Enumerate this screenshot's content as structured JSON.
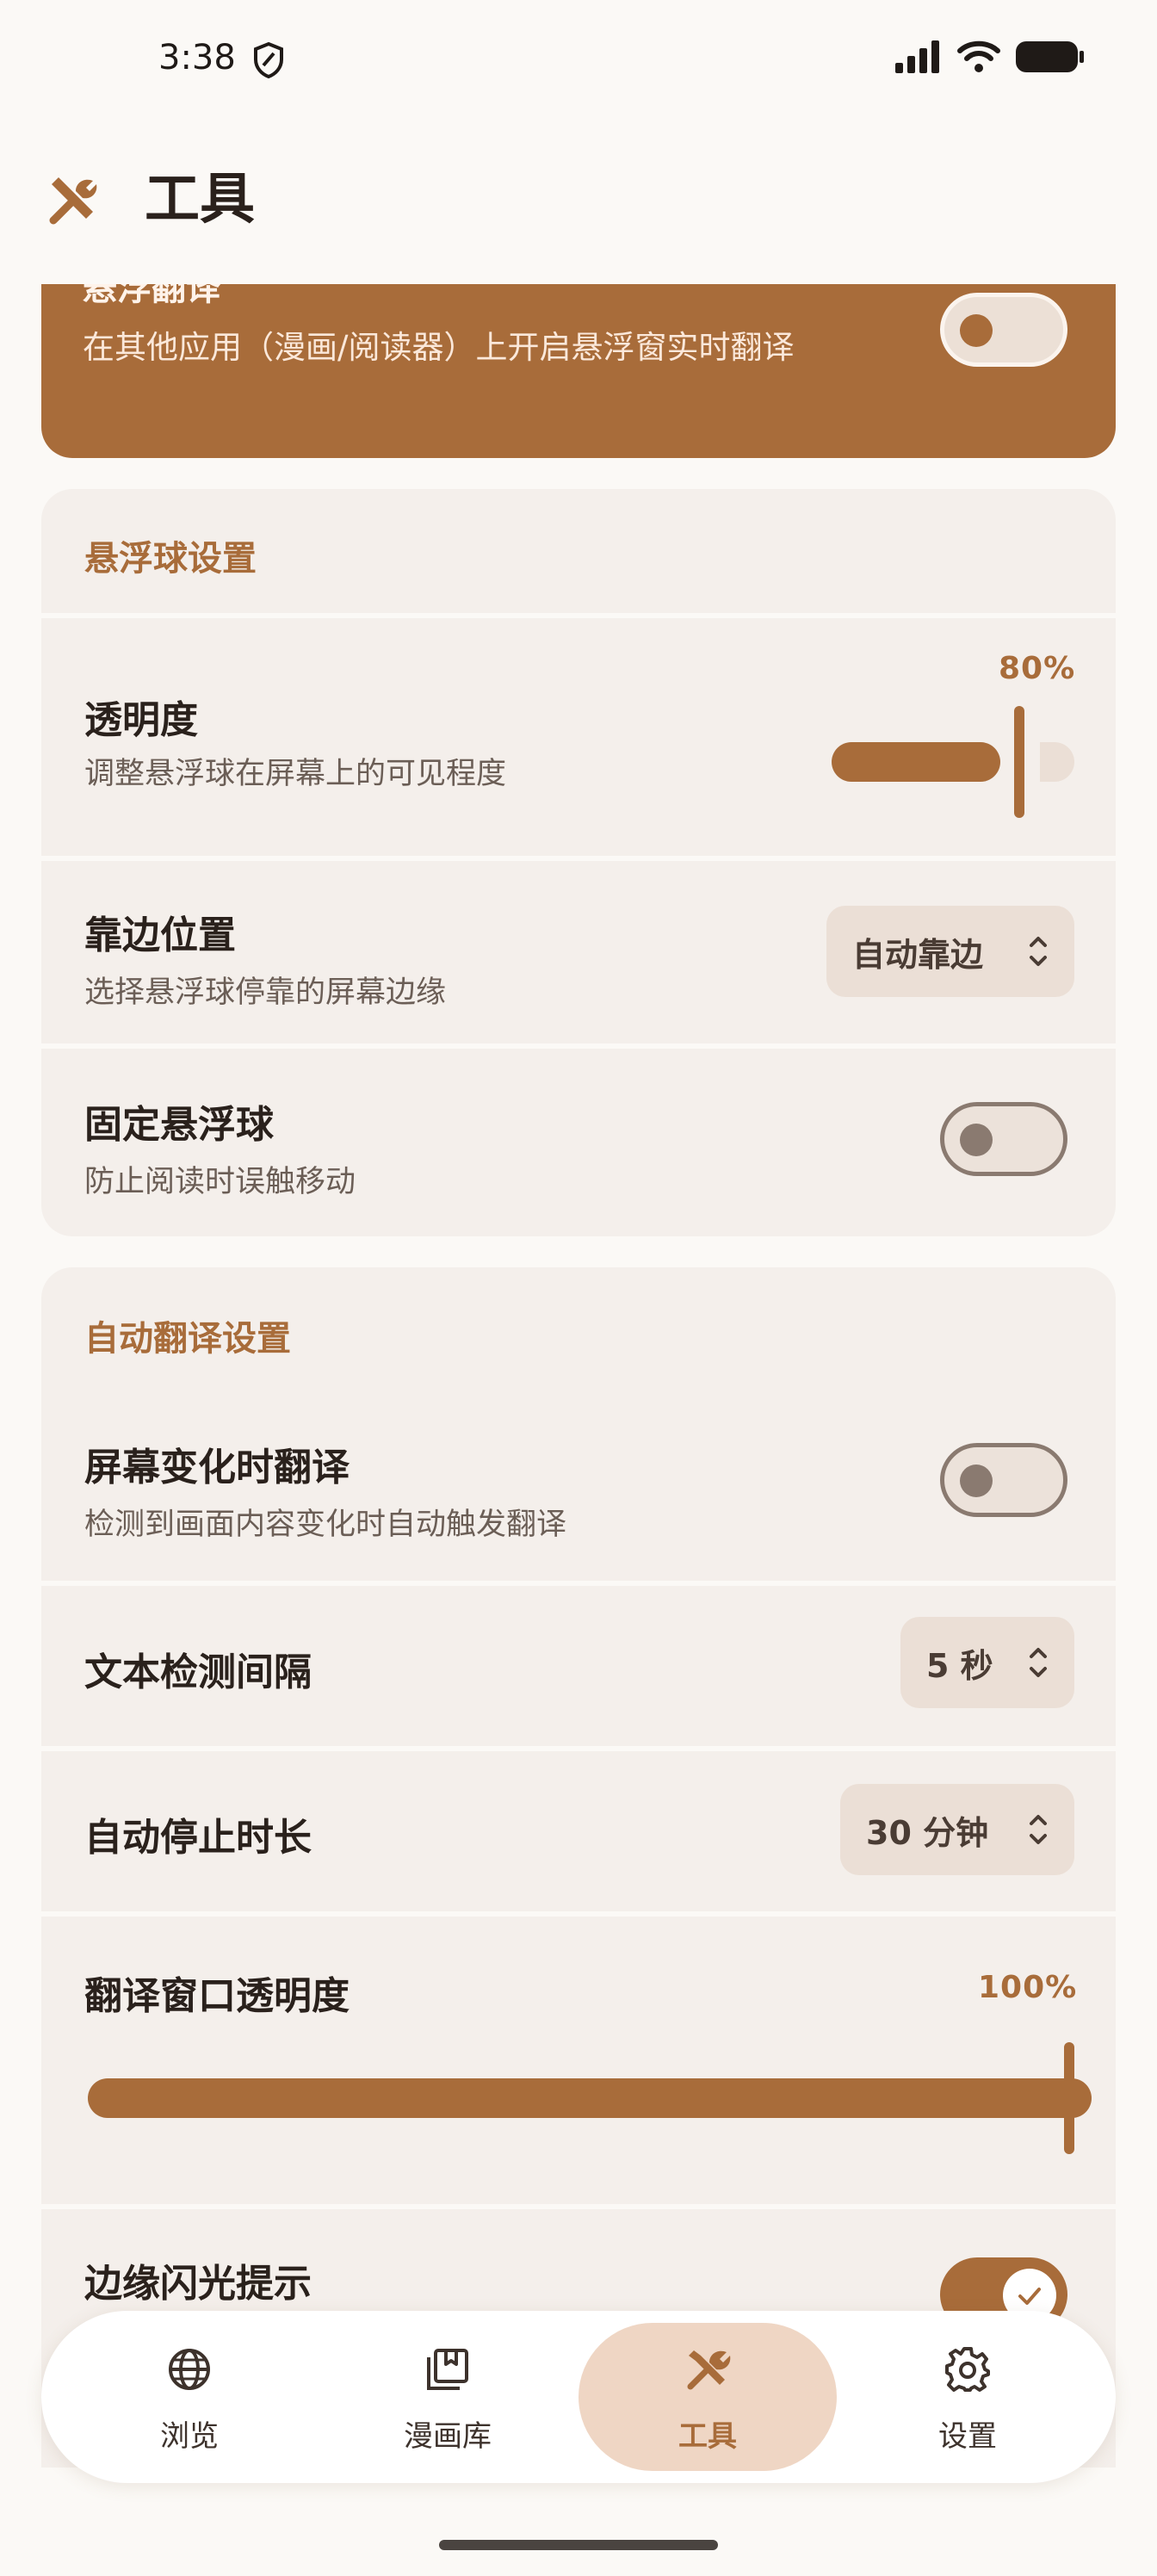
{
  "status_bar": {
    "time": "3:38"
  },
  "app_bar": {
    "title": "工具"
  },
  "overlay_translate": {
    "title": "悬浮翻译",
    "description": "在其他应用（漫画/阅读器）上开启悬浮窗实时翻译",
    "enabled": false
  },
  "float_ball": {
    "section_title": "悬浮球设置",
    "opacity": {
      "title": "透明度",
      "description": "调整悬浮球在屏幕上的可见程度",
      "value_label": "80%",
      "value": 0.8
    },
    "dock": {
      "title": "靠边位置",
      "description": "选择悬浮球停靠的屏幕边缘",
      "selected": "自动靠边"
    },
    "lock": {
      "title": "固定悬浮球",
      "description": "防止阅读时误触移动",
      "enabled": false
    }
  },
  "auto_translate": {
    "section_title": "自动翻译设置",
    "on_change": {
      "title": "屏幕变化时翻译",
      "description": "检测到画面内容变化时自动触发翻译",
      "enabled": false
    },
    "interval": {
      "title": "文本检测间隔",
      "selected": "5 秒"
    },
    "auto_stop": {
      "title": "自动停止时长",
      "selected": "30 分钟"
    },
    "window_opacity": {
      "title": "翻译窗口透明度",
      "value_label": "100%",
      "value": 1.0
    },
    "edge_flash": {
      "title": "边缘闪光提示",
      "enabled": true
    }
  },
  "bottom_nav": {
    "items": [
      {
        "label": "浏览",
        "icon": "globe-icon"
      },
      {
        "label": "漫画库",
        "icon": "library-icon"
      },
      {
        "label": "工具",
        "icon": "tools-icon"
      },
      {
        "label": "设置",
        "icon": "gear-icon"
      }
    ],
    "active_index": 2
  },
  "colors": {
    "accent": "#a86c3a",
    "card": "#f4efeb",
    "background": "#fbf9f6",
    "active_pill": "#efd6c4"
  }
}
